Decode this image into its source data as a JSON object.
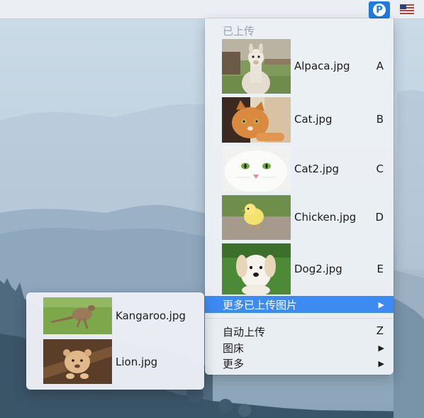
{
  "menubar": {
    "app_icon": "picgo-p-icon",
    "app_letter": "P",
    "flag_icon": "us-flag-icon"
  },
  "menu": {
    "section_header": "已上传",
    "uploaded": [
      {
        "label": "Alpaca.jpg",
        "shortcut": "A",
        "thumb": "alpaca-photo"
      },
      {
        "label": "Cat.jpg",
        "shortcut": "B",
        "thumb": "cat-photo"
      },
      {
        "label": "Cat2.jpg",
        "shortcut": "C",
        "thumb": "white-cat-photo"
      },
      {
        "label": "Chicken.jpg",
        "shortcut": "D",
        "thumb": "chick-photo"
      },
      {
        "label": "Dog2.jpg",
        "shortcut": "E",
        "thumb": "puppy-photo"
      }
    ],
    "more_uploaded": {
      "label": "更多已上传图片",
      "arrow": "▶"
    },
    "auto_upload": {
      "label": "自动上传",
      "shortcut": "Z"
    },
    "image_host": {
      "label": "图床",
      "arrow": "▶"
    },
    "more": {
      "label": "更多",
      "arrow": "▶"
    }
  },
  "submenu": {
    "items": [
      {
        "label": "Kangaroo.jpg",
        "thumb": "kangaroo-photo"
      },
      {
        "label": "Lion.jpg",
        "thumb": "lion-cub-photo"
      }
    ]
  },
  "colors": {
    "highlight": "#3d8bf0",
    "app_icon": "#1f7be0"
  }
}
